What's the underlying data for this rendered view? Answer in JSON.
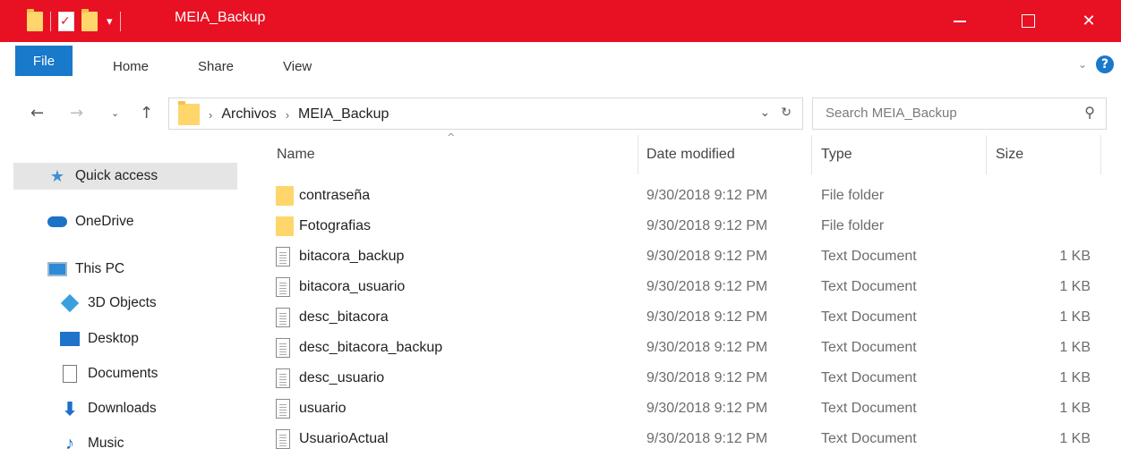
{
  "window": {
    "title": "MEIA_Backup",
    "accent": "#e81123",
    "minimize_glyph": "—",
    "maximize_glyph": "☐",
    "close_glyph": "✕"
  },
  "ribbon": {
    "tabs": [
      "File",
      "Home",
      "Share",
      "View"
    ]
  },
  "address": {
    "crumbs": [
      "Archivos",
      "MEIA_Backup"
    ],
    "search_placeholder": "Search MEIA_Backup"
  },
  "nav": {
    "quick_access": "Quick access",
    "onedrive": "OneDrive",
    "this_pc": "This PC",
    "objects3d": "3D Objects",
    "desktop": "Desktop",
    "documents": "Documents",
    "downloads": "Downloads",
    "music": "Music"
  },
  "columns": {
    "name": "Name",
    "date": "Date modified",
    "type": "Type",
    "size": "Size"
  },
  "files": [
    {
      "name": "contraseña",
      "date": "9/30/2018 9:12 PM",
      "type": "File folder",
      "size": "",
      "icon": "folder-icon"
    },
    {
      "name": "Fotografias",
      "date": "9/30/2018 9:12 PM",
      "type": "File folder",
      "size": "",
      "icon": "folder-icon"
    },
    {
      "name": "bitacora_backup",
      "date": "9/30/2018 9:12 PM",
      "type": "Text Document",
      "size": "1 KB",
      "icon": "text-file-icon"
    },
    {
      "name": "bitacora_usuario",
      "date": "9/30/2018 9:12 PM",
      "type": "Text Document",
      "size": "1 KB",
      "icon": "text-file-icon"
    },
    {
      "name": "desc_bitacora",
      "date": "9/30/2018 9:12 PM",
      "type": "Text Document",
      "size": "1 KB",
      "icon": "text-file-icon"
    },
    {
      "name": "desc_bitacora_backup",
      "date": "9/30/2018 9:12 PM",
      "type": "Text Document",
      "size": "1 KB",
      "icon": "text-file-icon"
    },
    {
      "name": "desc_usuario",
      "date": "9/30/2018 9:12 PM",
      "type": "Text Document",
      "size": "1 KB",
      "icon": "text-file-icon"
    },
    {
      "name": "usuario",
      "date": "9/30/2018 9:12 PM",
      "type": "Text Document",
      "size": "1 KB",
      "icon": "text-file-icon"
    },
    {
      "name": "UsuarioActual",
      "date": "9/30/2018 9:12 PM",
      "type": "Text Document",
      "size": "1 KB",
      "icon": "text-file-icon"
    }
  ]
}
